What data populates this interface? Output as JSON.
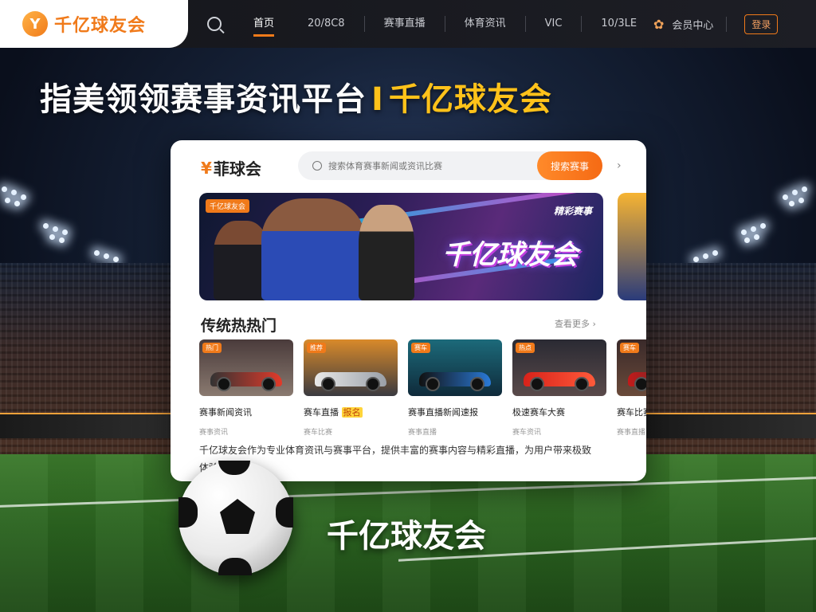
{
  "nav": {
    "logo_icon": "Y",
    "logo_text": "千亿球友会",
    "items": [
      {
        "label": "首页",
        "active": true
      },
      {
        "label": "20/8C8"
      },
      {
        "label": "赛事直播"
      },
      {
        "label": "体育资讯"
      },
      {
        "label": "VIC"
      },
      {
        "label": "10/3LE"
      }
    ],
    "user_icon": "user-icon",
    "user_label": "会员中心",
    "login_label": "登录"
  },
  "headline": {
    "main": "指美领领赛事资讯平台",
    "separator": "I",
    "brand": "千亿球友会"
  },
  "card": {
    "logo_prefix": "¥",
    "logo_text": "菲球会",
    "search_placeholder": "搜索体育赛事新闻或资讯比赛",
    "search_button": "搜索赛事",
    "banner": {
      "badge": "千亿球友会",
      "subtitle": "精彩赛事",
      "title": "千亿球友会"
    },
    "section_title": "传统热热门",
    "section_more": "查看更多 ›",
    "cars": [
      {
        "tag": "热门",
        "title": "赛事新闻资讯",
        "highlight": "",
        "meta": "赛事资讯"
      },
      {
        "tag": "推荐",
        "title": "赛车直播",
        "highlight": "报名",
        "meta": "赛车比赛"
      },
      {
        "tag": "赛车",
        "title": "赛事直播新闻速报",
        "highlight": "",
        "meta": "赛事直播"
      },
      {
        "tag": "热点",
        "title": "极速赛车大赛",
        "highlight": "",
        "meta": "赛车资讯"
      },
      {
        "tag": "赛车",
        "title": "赛车比赛",
        "highlight": "",
        "meta": "赛事直播"
      }
    ],
    "description": "千亿球友会作为专业体育资讯与赛事平台，提供丰富的赛事内容与精彩直播，为用户带来极致体验。"
  },
  "tagline": "千亿球友会",
  "colors": {
    "accent": "#f07a1a",
    "brand_yellow": "#ffc21a"
  }
}
